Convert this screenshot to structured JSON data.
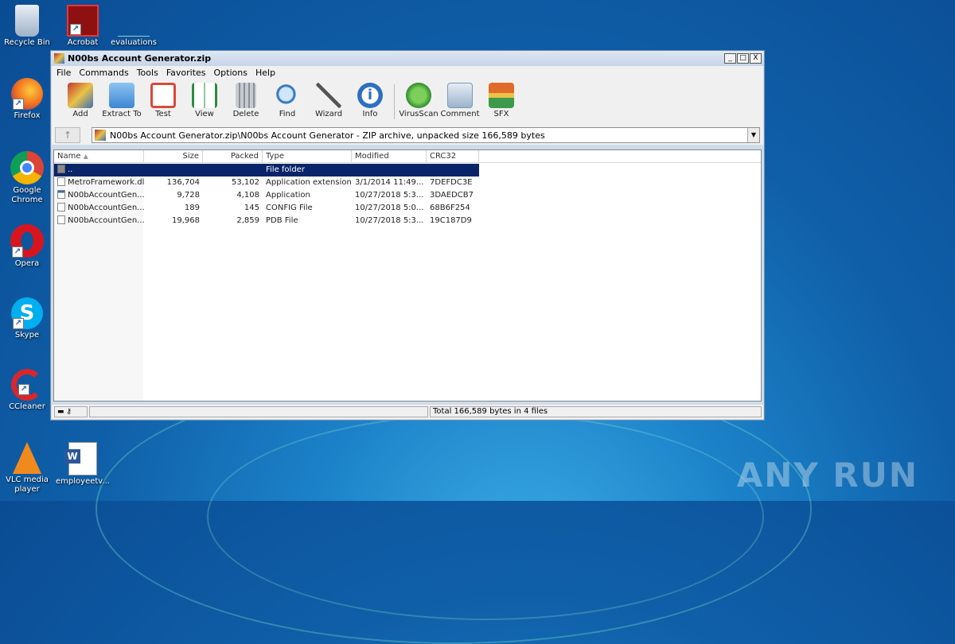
{
  "desktop": {
    "icons": [
      {
        "label": "Recycle Bin"
      },
      {
        "label": "Acrobat"
      },
      {
        "label": "evaluations"
      },
      {
        "label": "Firefox"
      },
      {
        "label": "Google Chrome"
      },
      {
        "label": "Opera"
      },
      {
        "label": "Skype"
      },
      {
        "label": "CCleaner"
      },
      {
        "label": "VLC media player"
      },
      {
        "label": "employeetv..."
      }
    ],
    "watermark": "ANY RUN"
  },
  "window": {
    "title": "N00bs Account Generator.zip",
    "buttons": {
      "minimize": "_",
      "maximize": "□",
      "close": "X"
    }
  },
  "menu": [
    "File",
    "Commands",
    "Tools",
    "Favorites",
    "Options",
    "Help"
  ],
  "toolbar": {
    "buttons": [
      {
        "label": "Add",
        "icon": "add-icon",
        "color": "#c53a2e"
      },
      {
        "label": "Extract To",
        "icon": "folder-icon",
        "color": "#4a90d9"
      },
      {
        "label": "Test",
        "icon": "checklist-icon",
        "color": "#d94a3a"
      },
      {
        "label": "View",
        "icon": "book-icon",
        "color": "#2e8b3e"
      },
      {
        "label": "Delete",
        "icon": "trash-icon",
        "color": "#8a8f98"
      },
      {
        "label": "Find",
        "icon": "magnifier-icon",
        "color": "#3a7cc5"
      },
      {
        "label": "Wizard",
        "icon": "wand-icon",
        "color": "#7aa03a"
      },
      {
        "label": "Info",
        "icon": "info-icon",
        "color": "#2d6fc0"
      },
      {
        "label": "VirusScan",
        "icon": "bug-icon",
        "color": "#3aa03a"
      },
      {
        "label": "Comment",
        "icon": "comment-icon",
        "color": "#7a9ab8"
      },
      {
        "label": "SFX",
        "icon": "sfx-icon",
        "color": "#e06a2a"
      }
    ]
  },
  "address": {
    "up": "↑",
    "path": "N00bs Account Generator.zip\\N00bs Account Generator - ZIP archive, unpacked size 166,589 bytes"
  },
  "list": {
    "columns": [
      "Name",
      "Size",
      "Packed",
      "Type",
      "Modified",
      "CRC32"
    ],
    "rows": [
      {
        "name": "..",
        "size": "",
        "packed": "",
        "type": "File folder",
        "modified": "",
        "crc": ""
      },
      {
        "name": "MetroFramework.dll",
        "size": "136,704",
        "packed": "53,102",
        "type": "Application extension",
        "modified": "3/1/2014 11:49...",
        "crc": "7DEFDC3E"
      },
      {
        "name": "N00bAccountGen...",
        "size": "9,728",
        "packed": "4,108",
        "type": "Application",
        "modified": "10/27/2018 5:3...",
        "crc": "3DAEDCB7"
      },
      {
        "name": "N00bAccountGen...",
        "size": "189",
        "packed": "145",
        "type": "CONFIG File",
        "modified": "10/27/2018 5:0...",
        "crc": "68B6F254"
      },
      {
        "name": "N00bAccountGen...",
        "size": "19,968",
        "packed": "2,859",
        "type": "PDB File",
        "modified": "10/27/2018 5:3...",
        "crc": "19C187D9"
      }
    ]
  },
  "status": {
    "total": "Total 166,589 bytes in 4 files"
  }
}
